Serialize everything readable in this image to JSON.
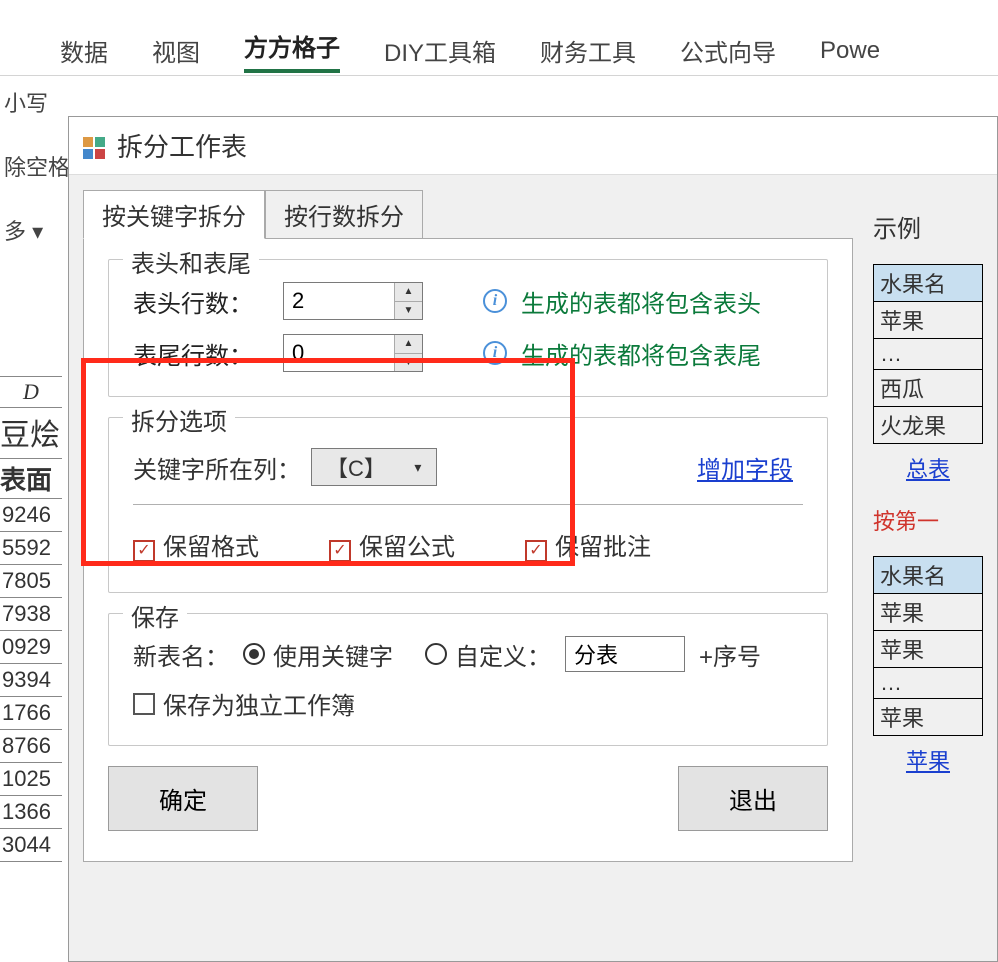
{
  "ribbon": {
    "tabs": [
      "数据",
      "视图",
      "方方格子",
      "DIY工具箱",
      "财务工具",
      "公式向导",
      "Powe"
    ],
    "active": "方方格子",
    "left_labels": [
      "小写",
      "除空格",
      "多 ▾"
    ]
  },
  "sheet": {
    "col_letter": "D",
    "cells": [
      "豆烩",
      "表面",
      "9246",
      "5592",
      "7805",
      "7938",
      "0929",
      "9394",
      "1766",
      "8766",
      "1025",
      "1366",
      "3044"
    ]
  },
  "dialog": {
    "title": "拆分工作表",
    "tabs": [
      "按关键字拆分",
      "按行数拆分"
    ],
    "active_tab": "按关键字拆分",
    "header_footer": {
      "legend": "表头和表尾",
      "head_label": "表头行数：",
      "head_value": "2",
      "head_hint": "生成的表都将包含表头",
      "tail_label": "表尾行数：",
      "tail_value": "0",
      "tail_hint": "生成的表都将包含表尾"
    },
    "split_options": {
      "legend": "拆分选项",
      "key_col_label": "关键字所在列：",
      "key_col_value": "【C】",
      "add_field": "增加字段",
      "keep_format": "保留格式",
      "keep_formula": "保留公式",
      "keep_comment": "保留批注"
    },
    "save": {
      "legend": "保存",
      "new_name_label": "新表名：",
      "use_keyword": "使用关键字",
      "custom": "自定义：",
      "custom_value": "分表",
      "suffix": "+序号",
      "save_independent": "保存为独立工作簿"
    },
    "ok": "确定",
    "exit": "退出"
  },
  "example": {
    "title": "示例",
    "table1": {
      "header": "水果名",
      "rows": [
        "苹果",
        "…",
        "西瓜",
        "火龙果"
      ],
      "caption": "总表"
    },
    "red_text": "按第一",
    "table2": {
      "header": "水果名",
      "rows": [
        "苹果",
        "苹果",
        "…",
        "苹果"
      ],
      "caption": "苹果"
    }
  }
}
